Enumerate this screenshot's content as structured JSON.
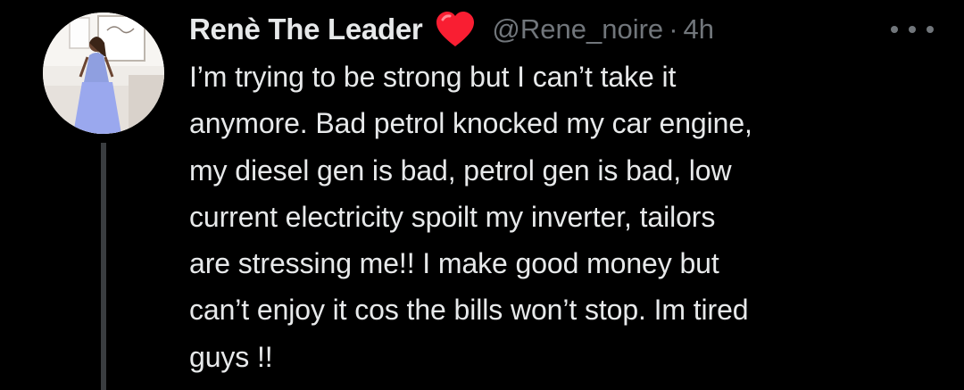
{
  "tweet": {
    "author": {
      "display_name": "Renè The Leader",
      "badge_emoji": "red-heart-icon",
      "handle": "@Rene_noire",
      "separator": "·",
      "time_ago": "4h"
    },
    "text": "I’m trying to be strong but I can’t take it\nanymore. Bad petrol knocked my car engine,\nmy diesel gen is bad, petrol gen is bad, low\ncurrent electricity spoilt my inverter, tailors\nare stressing me!! I make good money but\ncan’t enjoy it cos the bills won’t stop. Im tired\nguys !!",
    "more_menu_icon": "more-horizontal-icon"
  },
  "colors": {
    "background": "#000000",
    "text_primary": "#e7e9ea",
    "text_secondary": "#71767b",
    "heart": "#f91e32",
    "thread_line": "#3a3d40"
  }
}
